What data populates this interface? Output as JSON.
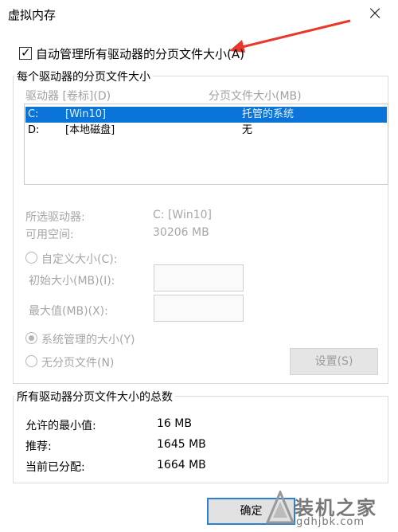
{
  "window": {
    "title": "虚拟内存",
    "close_glyph": "×"
  },
  "auto_manage": {
    "checked": true,
    "label": "自动管理所有驱动器的分页文件大小(A)"
  },
  "per_drive": {
    "group_title": "每个驱动器的分页文件大小",
    "col_drive": "驱动器 [卷标](D)",
    "col_size": "分页文件大小(MB)",
    "drives": [
      {
        "letter": "C:",
        "label": "[Win10]",
        "size": "托管的系统",
        "selected": true
      },
      {
        "letter": "D:",
        "label": "[本地磁盘]",
        "size": "无",
        "selected": false
      }
    ],
    "selected_drive_label": "所选驱动器:",
    "selected_drive_value": "C:  [Win10]",
    "free_space_label": "可用空间:",
    "free_space_value": "30206 MB",
    "custom_size_label": "自定义大小(C):",
    "initial_size_label": "初始大小(MB)(I):",
    "max_size_label": "最大值(MB)(X):",
    "system_managed_label": "系统管理的大小(Y)",
    "no_paging_label": "无分页文件(N)",
    "set_button": "设置(S)"
  },
  "totals": {
    "group_title": "所有驱动器分页文件大小的总数",
    "min_label": "允许的最小值:",
    "min_value": "16 MB",
    "recommended_label": "推荐:",
    "recommended_value": "1645 MB",
    "allocated_label": "当前已分配:",
    "allocated_value": "1664 MB"
  },
  "buttons": {
    "ok": "确定"
  },
  "watermark": {
    "brand": "装机之家",
    "url": "gdhjbk.com"
  },
  "colors": {
    "selection": "#0a74d8",
    "arrow": "#e8372c",
    "primary_border": "#2d7fd2"
  }
}
